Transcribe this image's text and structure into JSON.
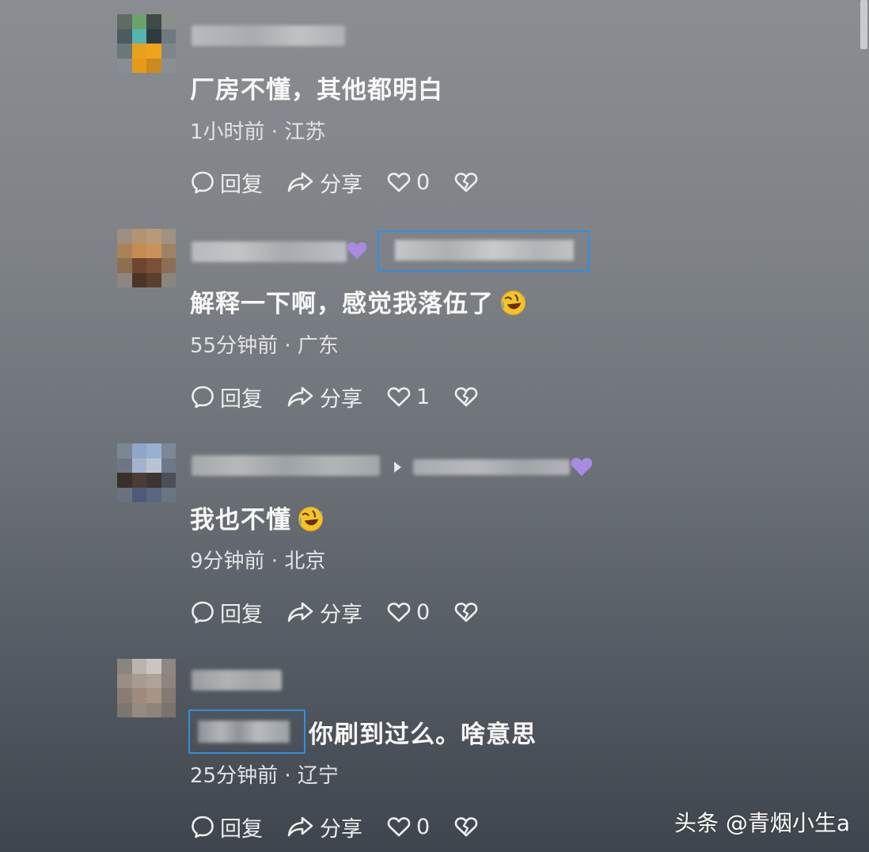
{
  "comments": [
    {
      "text": "厂房不懂，其他都明白",
      "meta": "1小时前 · 江苏",
      "reply_label": "回复",
      "share_label": "分享",
      "likes": "0"
    },
    {
      "text": "解释一下啊，感觉我落伍了",
      "meta": "55分钟前 · 广东",
      "reply_label": "回复",
      "share_label": "分享",
      "likes": "1",
      "emoji": "rolling-on-floor-laughing-emoji"
    },
    {
      "text": "我也不懂",
      "meta": "9分钟前 · 北京",
      "reply_label": "回复",
      "share_label": "分享",
      "likes": "0",
      "emoji": "rolling-on-floor-laughing-emoji"
    },
    {
      "text": "你刷到过么。啥意思",
      "meta": "25分钟前 · 辽宁",
      "reply_label": "回复",
      "share_label": "分享",
      "likes": "0"
    }
  ],
  "watermark": "头条 @青烟小生a",
  "colors": {
    "highlight_border": "#2f8fe6",
    "vip_heart": "#a78be0"
  }
}
